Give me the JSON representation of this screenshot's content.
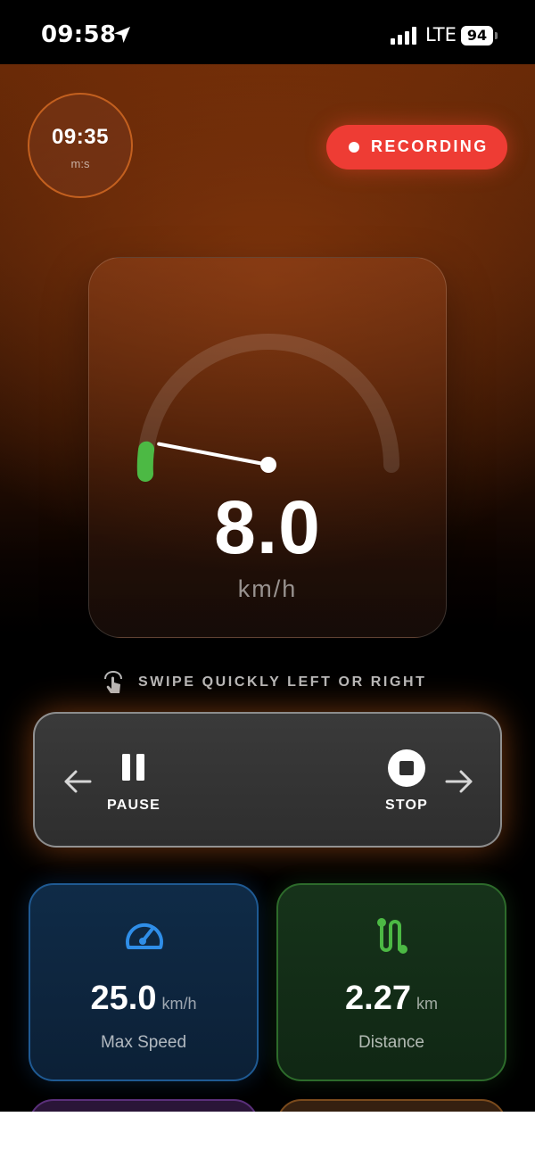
{
  "status_bar": {
    "time": "09:58",
    "network": "LTE",
    "battery": "94"
  },
  "timer": {
    "value": "09:35",
    "unit": "m:s"
  },
  "recording": {
    "label": "RECORDING",
    "color": "#ee3c34"
  },
  "speedometer": {
    "value": "8.0",
    "unit": "km/h",
    "level": 0.04,
    "indicator_color": "#4cb944"
  },
  "swipe_hint": {
    "text": "SWIPE QUICKLY LEFT OR RIGHT",
    "icon": "hand-tap-icon"
  },
  "controls": {
    "pause_label": "PAUSE",
    "stop_label": "STOP",
    "left_icon": "arrow-left-icon",
    "right_icon": "arrow-right-icon"
  },
  "stats": {
    "max_speed": {
      "value": "25.0",
      "unit": "km/h",
      "label": "Max Speed",
      "icon": "speedometer-icon",
      "color": "#2f8ee8"
    },
    "distance": {
      "value": "2.27",
      "unit": "km",
      "label": "Distance",
      "icon": "route-icon",
      "color": "#4cb944"
    }
  },
  "theme": {
    "accent": "#c3601f",
    "background": "#000000"
  }
}
